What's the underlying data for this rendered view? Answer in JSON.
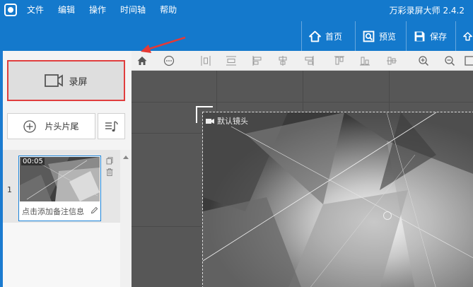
{
  "titlebar": {
    "menu": [
      "文件",
      "编辑",
      "操作",
      "时间轴",
      "帮助"
    ],
    "app_title": "万彩录屏大师 2.4.2"
  },
  "toolbar": {
    "home_label": "首页",
    "preview_label": "预览",
    "save_label": "保存"
  },
  "left_panel": {
    "record_label": "录屏",
    "intro_outro_label": "片头片尾",
    "clips": [
      {
        "index": "1",
        "duration": "00:05",
        "note_placeholder": "点击添加备注信息"
      }
    ]
  },
  "editor_toolbar": {
    "icons": [
      "home-icon",
      "more-icon",
      "align-distribute-horizontal-icon",
      "align-distribute-vertical-icon",
      "align-left-icon",
      "align-center-horizontal-icon",
      "align-right-icon",
      "align-top-icon",
      "align-bottom-icon",
      "align-center-vertical-icon",
      "zoom-in-icon",
      "zoom-out-icon",
      "fit-icon"
    ]
  },
  "canvas": {
    "camera_label": "默认镜头"
  },
  "colors": {
    "brand_blue": "#1479cc",
    "highlight_red": "#e03e3e",
    "clip_border": "#1a83d9"
  }
}
